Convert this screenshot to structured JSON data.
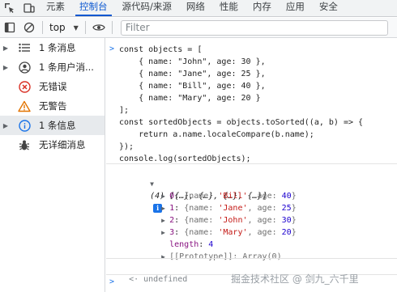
{
  "tabs": [
    "元素",
    "控制台",
    "源代码/来源",
    "网络",
    "性能",
    "内存",
    "应用",
    "安全"
  ],
  "active_tab": "控制台",
  "toolbar": {
    "context": "top",
    "filter_placeholder": "Filter"
  },
  "sidebar": [
    {
      "icon": "list-icon",
      "label": "1 条消息",
      "expandable": true
    },
    {
      "icon": "user-icon",
      "label": "1 条用户消...",
      "expandable": true
    },
    {
      "icon": "error-icon",
      "label": "无错误",
      "expandable": false
    },
    {
      "icon": "warning-icon",
      "label": "无警告",
      "expandable": false
    },
    {
      "icon": "info-icon",
      "label": "1 条信息",
      "expandable": true,
      "selected": true
    },
    {
      "icon": "bug-icon",
      "label": "无详细消息",
      "expandable": false
    }
  ],
  "code": {
    "line1": "const objects = [",
    "line2": "    { name: \"John\", age: 30 },",
    "line3": "    { name: \"Jane\", age: 25 },",
    "line4": "    { name: \"Bill\", age: 40 },",
    "line5": "    { name: \"Mary\", age: 20 }",
    "line6": "];",
    "line7": "const sortedObjects = objects.toSorted((a, b) => {",
    "line8": "    return a.name.localeCompare(b.name);",
    "line9": "});",
    "line10": "console.log(sortedObjects);"
  },
  "output": {
    "summary": "(4) [{…}, {…}, {…}, {…}]",
    "rows": [
      {
        "index": "0",
        "name": "'Bill'",
        "age": "40"
      },
      {
        "index": "1",
        "name": "'Jane'",
        "age": "25"
      },
      {
        "index": "2",
        "name": "'John'",
        "age": "30"
      },
      {
        "index": "3",
        "name": "'Mary'",
        "age": "20"
      }
    ],
    "length_label": "length",
    "length_value": "4",
    "prototype": "[[Prototype]]: Array(0)",
    "return_value": "undefined",
    "info_badge": "i"
  },
  "watermark": "掘金技术社区 @ 剑九_六千里",
  "colors": {
    "accent": "#0b57d0",
    "error": "#d93025",
    "warning": "#e37400",
    "info": "#1a73e8"
  }
}
